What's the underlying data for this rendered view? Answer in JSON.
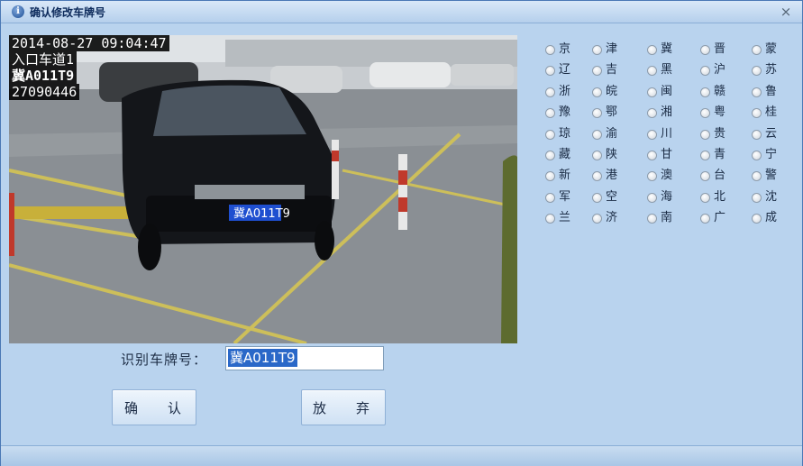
{
  "window": {
    "title": "确认修改车牌号",
    "close_glyph": "×"
  },
  "camera": {
    "timestamp": "2014-08-27  09:04:47",
    "lane": "入口车道1",
    "plate_overlay": "冀A011T9",
    "serial": "27090446",
    "car_plate": "冀A011T9"
  },
  "provinces": [
    "京",
    "津",
    "冀",
    "晋",
    "蒙",
    "辽",
    "吉",
    "黑",
    "沪",
    "苏",
    "浙",
    "皖",
    "闽",
    "赣",
    "鲁",
    "豫",
    "鄂",
    "湘",
    "粤",
    "桂",
    "琼",
    "渝",
    "川",
    "贵",
    "云",
    "藏",
    "陕",
    "甘",
    "青",
    "宁",
    "新",
    "港",
    "澳",
    "台",
    "警",
    "军",
    "空",
    "海",
    "北",
    "沈",
    "兰",
    "济",
    "南",
    "广",
    "成"
  ],
  "form": {
    "plate_label": "识别车牌号：",
    "plate_value": "冀A011T9"
  },
  "buttons": {
    "confirm_left": "确",
    "confirm_right": "认",
    "cancel_left": "放",
    "cancel_right": "弃"
  }
}
